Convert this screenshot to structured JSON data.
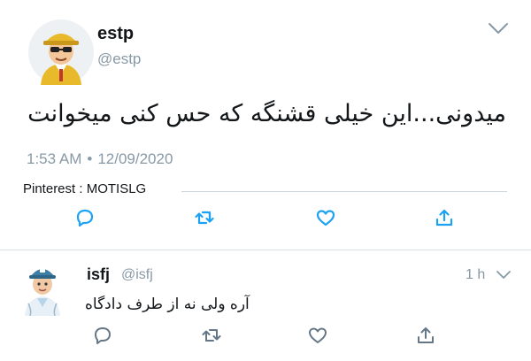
{
  "tweet": {
    "display_name": "estp",
    "handle": "@estp",
    "text": "میدونی...این خیلی قشنگه که حس کنی میخوانت",
    "time": "1:53 AM",
    "separator": "•",
    "date": "12/09/2020",
    "watermark": "Pinterest : MOTISLG",
    "icons": [
      "chevron-down",
      "reply",
      "retweet",
      "like",
      "share"
    ]
  },
  "reply": {
    "display_name": "isfj",
    "handle": "@isfj",
    "age": "1 h",
    "text": "آره ولی نه از طرف دادگاه",
    "icons": [
      "chevron-down",
      "reply",
      "retweet",
      "like",
      "share"
    ]
  },
  "colors": {
    "text": "#14171a",
    "muted": "#8899a6",
    "divider": "#d8dfe4",
    "icon": "#657786",
    "share_icon": "#1da1f2"
  }
}
